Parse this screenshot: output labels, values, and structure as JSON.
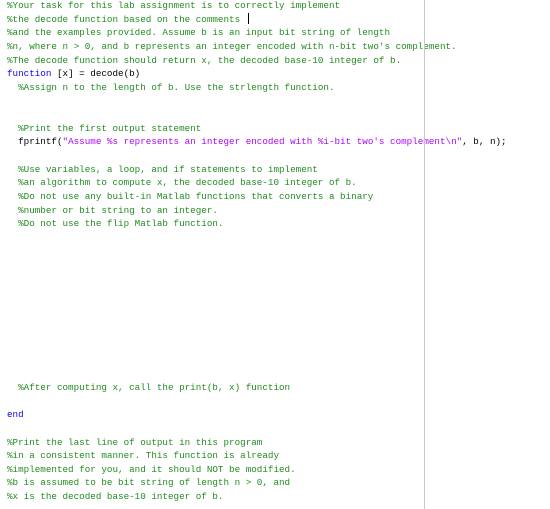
{
  "colors": {
    "comment": "#228B22",
    "keyword": "#0E00FF",
    "string": "#A709F5",
    "plain": "#000000"
  },
  "editor": {
    "language": "MATLAB",
    "cursor": {
      "line": 2
    },
    "lines": [
      [
        [
          "comment",
          "%Your task for this lab assignment is to correctly implement"
        ]
      ],
      [
        [
          "comment",
          "%the decode function based on the comments "
        ]
      ],
      [
        [
          "comment",
          "%and the examples provided. Assume b is an input bit string of length"
        ]
      ],
      [
        [
          "comment",
          "%n, where n > 0, and b represents an integer encoded with n-bit two's complement."
        ]
      ],
      [
        [
          "comment",
          "%The decode function should return x, the decoded base-10 integer of b."
        ]
      ],
      [
        [
          "keyword",
          "function"
        ],
        [
          "plain",
          " [x] = decode(b)"
        ]
      ],
      [
        [
          "comment",
          "  %Assign n to the length of b. Use the strlength function."
        ]
      ],
      [],
      [],
      [
        [
          "comment",
          "  %Print the first output statement"
        ]
      ],
      [
        [
          "plain",
          "  fprintf("
        ],
        [
          "string",
          "\"Assume %s represents an integer encoded with %i-bit two's complement\\n\""
        ],
        [
          "plain",
          ", b, n);"
        ]
      ],
      [],
      [
        [
          "comment",
          "  %Use variables, a loop, and if statements to implement"
        ]
      ],
      [
        [
          "comment",
          "  %an algorithm to compute x, the decoded base-10 integer of b."
        ]
      ],
      [
        [
          "comment",
          "  %Do not use any built-in Matlab functions that converts a binary"
        ]
      ],
      [
        [
          "comment",
          "  %number or bit string to an integer."
        ]
      ],
      [
        [
          "comment",
          "  %Do not use the flip Matlab function."
        ]
      ],
      [],
      [],
      [],
      [],
      [],
      [],
      [],
      [],
      [],
      [],
      [],
      [
        [
          "comment",
          "  %After computing x, call the print(b, x) function"
        ]
      ],
      [],
      [
        [
          "keyword",
          "end"
        ]
      ],
      [],
      [
        [
          "comment",
          "%Print the last line of output in this program"
        ]
      ],
      [
        [
          "comment",
          "%in a consistent manner. This function is already"
        ]
      ],
      [
        [
          "comment",
          "%implemented for you, and it should NOT be modified."
        ]
      ],
      [
        [
          "comment",
          "%b is assumed to be bit string of length n > 0, and"
        ]
      ],
      [
        [
          "comment",
          "%x is the decoded base-10 integer of b."
        ]
      ]
    ]
  }
}
